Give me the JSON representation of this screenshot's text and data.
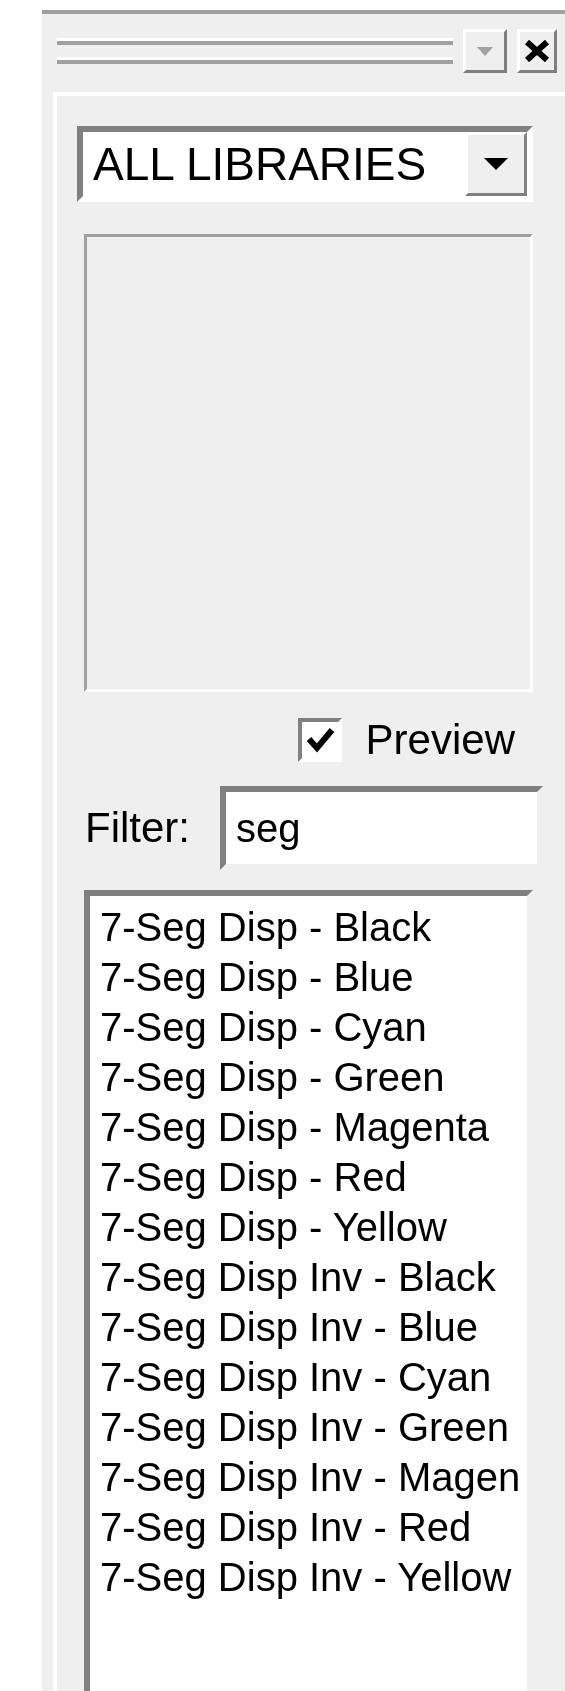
{
  "library_select": {
    "value": "ALL LIBRARIES"
  },
  "preview": {
    "label": "Preview",
    "checked": true
  },
  "filter": {
    "label": "Filter:",
    "value": "seg"
  },
  "components": [
    "7-Seg Disp - Black",
    "7-Seg Disp - Blue",
    "7-Seg Disp - Cyan",
    "7-Seg Disp - Green",
    "7-Seg Disp - Magenta",
    "7-Seg Disp - Red",
    "7-Seg Disp - Yellow",
    "7-Seg Disp Inv - Black",
    "7-Seg Disp Inv - Blue",
    "7-Seg Disp Inv - Cyan",
    "7-Seg Disp Inv - Green",
    "7-Seg Disp Inv - Magen",
    "7-Seg Disp Inv - Red",
    "7-Seg Disp Inv - Yellow"
  ]
}
